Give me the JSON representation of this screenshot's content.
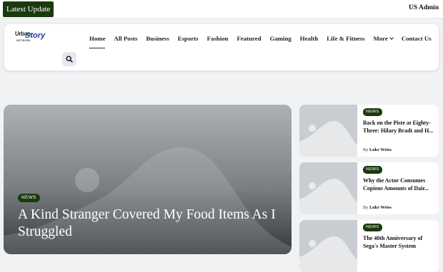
{
  "topbar": {
    "latest_label": "Latest Update",
    "admin_label": "US Admin"
  },
  "brand": {
    "logo_text_1": "Urban",
    "logo_text_2": "Story",
    "logo_text_3": "NETWORK",
    "accent_color": "#1a3a0e"
  },
  "nav": {
    "items": [
      {
        "label": "Home",
        "active": true
      },
      {
        "label": "All Posts"
      },
      {
        "label": "Business"
      },
      {
        "label": "Esports"
      },
      {
        "label": "Fashion"
      },
      {
        "label": "Featured"
      },
      {
        "label": "Gaming"
      },
      {
        "label": "Health"
      },
      {
        "label": "Life & Fitness"
      },
      {
        "label": "More",
        "has_dropdown": true
      },
      {
        "label": "Contact Us"
      }
    ],
    "search_icon": "search-icon"
  },
  "hero": {
    "badge": "NEWS",
    "title": "A Kind Stranger Covered My Food Items As I Struggled"
  },
  "side_posts": [
    {
      "badge": "NEWS",
      "title": "Back on the Piste at Eighty-Three: Hilary Bradt and H...",
      "by": "By",
      "author": "Luke Weiss"
    },
    {
      "badge": "NEWS",
      "title": "Why the Actor Consumes Copious Amounts of Dair...",
      "by": "By",
      "author": "Luke Weiss"
    },
    {
      "badge": "NEWS",
      "title": "The 40th Anniversary of Sega's Master System",
      "by": "",
      "author": ""
    }
  ]
}
